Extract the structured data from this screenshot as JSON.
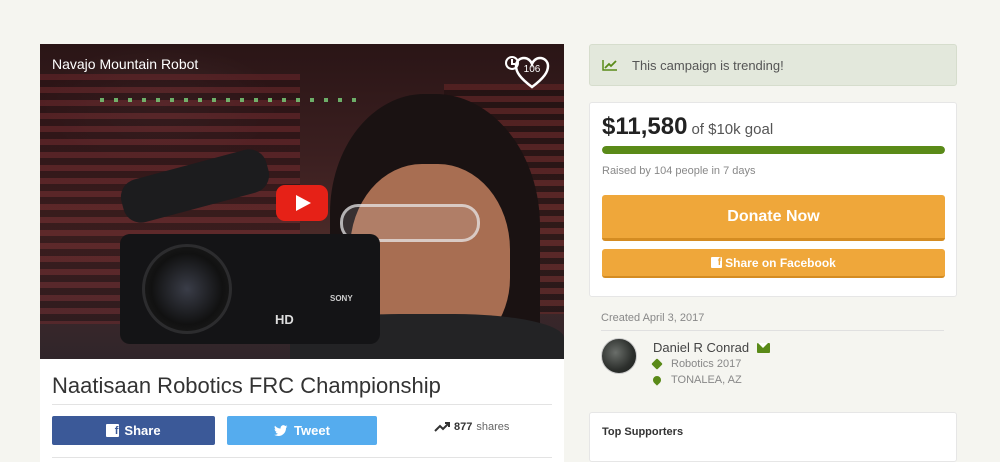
{
  "video": {
    "title": "Navajo Mountain Robot",
    "heart_count": "106",
    "camera_brand_text": "SONY",
    "camera_hd_text": "HD"
  },
  "campaign": {
    "title": "Naatisaan Robotics FRC Championship",
    "share_label": "Share",
    "tweet_label": "Tweet",
    "shares_count": "877",
    "shares_label": "shares"
  },
  "trending": {
    "text": "This campaign is trending!"
  },
  "funding": {
    "raised": "$11,580",
    "goal_text": "of $10k goal",
    "progress_fraction": 1.0,
    "raised_by": "Raised by 104 people in 7 days",
    "donate_label": "Donate Now",
    "facebook_share_label": "Share on Facebook"
  },
  "organizer": {
    "created": "Created April 3, 2017",
    "name": "Daniel R Conrad",
    "category": "Robotics 2017",
    "location": "TONALEA, AZ"
  },
  "supporters": {
    "title": "Top Supporters"
  },
  "colors": {
    "facebook": "#3b5998",
    "twitter": "#55acee",
    "donate": "#efa73a",
    "progress": "#5a8a18",
    "youtube_red": "#e62117"
  },
  "icons": {
    "video_clock": "clock-icon",
    "video_heart": "heart-icon",
    "trend": "trending-up-icon",
    "mail": "mail-icon",
    "category": "tag-icon",
    "location": "map-pin-icon"
  }
}
